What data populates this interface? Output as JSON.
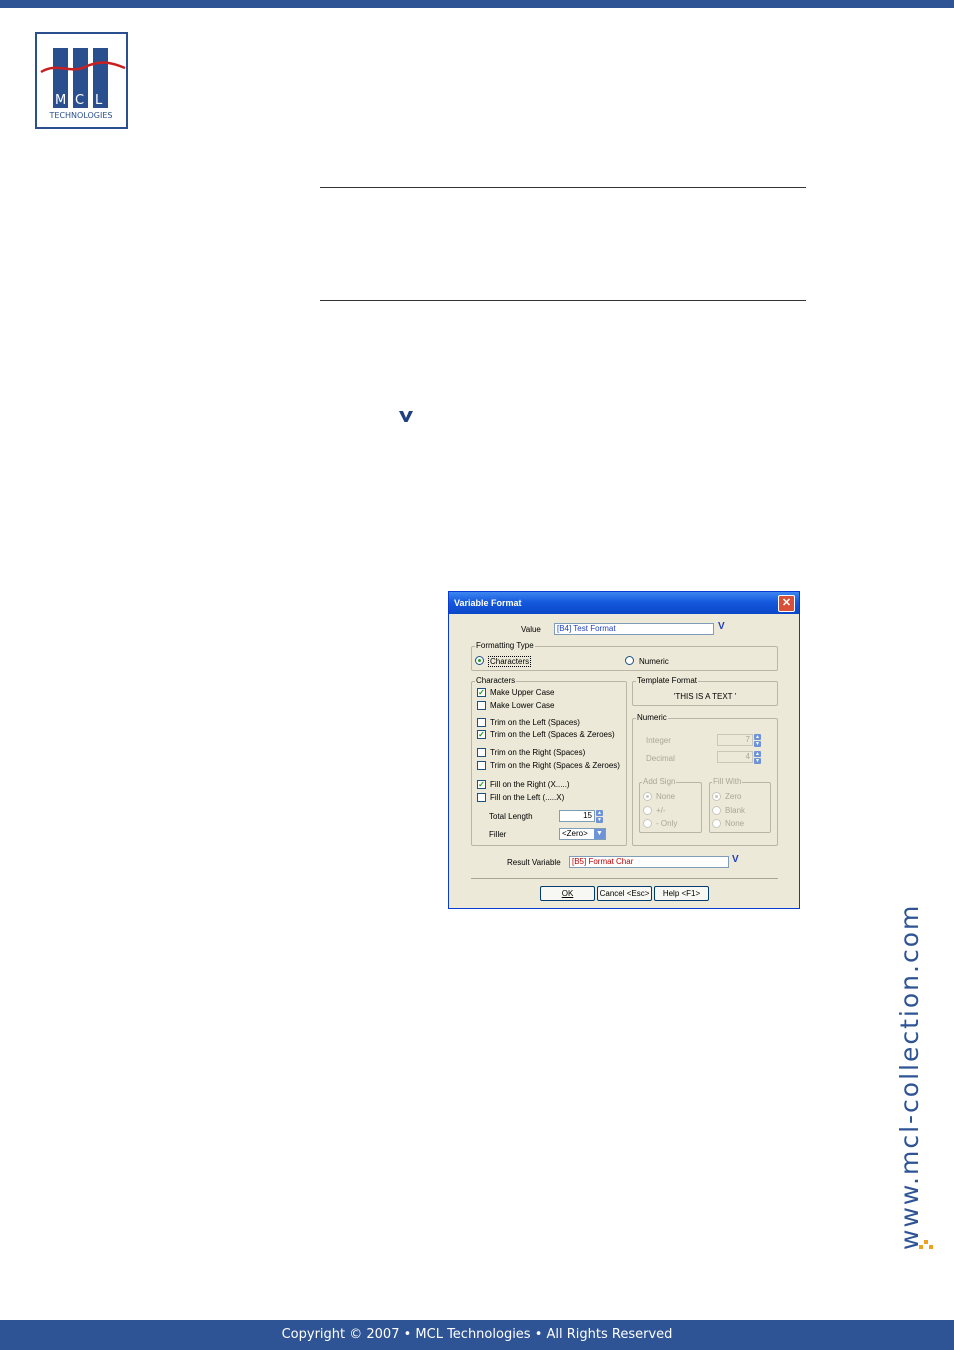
{
  "logo": {
    "letters": [
      "M",
      "C",
      "L"
    ],
    "subtitle": "TECHNOLOGIES"
  },
  "side_url": "www.mcl-collection.com",
  "footer": "Copyright © 2007 • MCL Technologies • All Rights Reserved",
  "colors": {
    "brand": "#2f5496",
    "xp_title": "#0b47c8",
    "check": "#21a121"
  },
  "dialog": {
    "title": "Variable Format",
    "value_label": "Value",
    "value_field": "[B4] Test Format",
    "formatting_type_label": "Formatting Type",
    "formatting_characters": "Characters",
    "formatting_numeric": "Numeric",
    "characters_group": "Characters",
    "upper_case": "Make Upper Case",
    "lower_case": "Make Lower Case",
    "trim_left_spaces": "Trim on the Left (Spaces)",
    "trim_left_spaces_zeroes": "Trim on the Left (Spaces & Zeroes)",
    "trim_right_spaces": "Trim on the Right (Spaces)",
    "trim_right_spaces_zeroes": "Trim on the Right (Spaces & Zeroes)",
    "fill_right": "Fill on the Right (X.....)",
    "fill_left": "Fill on the Left (.....X)",
    "total_length_label": "Total Length",
    "total_length_value": "15",
    "filler_label": "Filler",
    "filler_value": "<Zero>",
    "template_format_label": "Template Format",
    "template_format_value": "'THIS IS A TEXT '",
    "numeric_group": "Numeric",
    "integer_label": "Integer",
    "integer_value": "7",
    "decimal_label": "Decimal",
    "decimal_value": "4",
    "add_sign_label": "Add Sign",
    "sign_none": "None",
    "sign_plus_minus": "+/-",
    "sign_minus_only": "- Only",
    "fill_with_label": "Fill With",
    "fill_zero": "Zero",
    "fill_blank": "Blank",
    "fill_none": "None",
    "result_variable_label": "Result Variable",
    "result_variable_value": "[B5] Format Char",
    "ok_button": "OK",
    "cancel_button": "Cancel <Esc>",
    "help_button": "Help <F1>"
  }
}
